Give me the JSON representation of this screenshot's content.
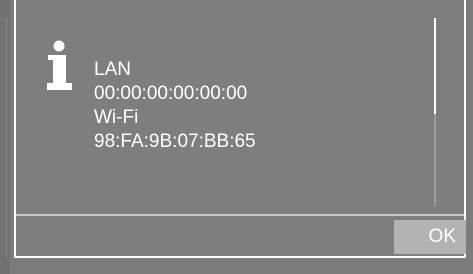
{
  "dialog": {
    "icon": "info-icon",
    "lines": [
      "LAN",
      "00:00:00:00:00:00",
      "Wi-Fi",
      "98:FA:9B:07:BB:65"
    ],
    "ok_label": "OK"
  },
  "colors": {
    "background": "#7b7b7b",
    "dialog_background": "#7e7e7e",
    "border": "#ffffff",
    "text": "#ffffff",
    "button": "#b3b3b3"
  }
}
